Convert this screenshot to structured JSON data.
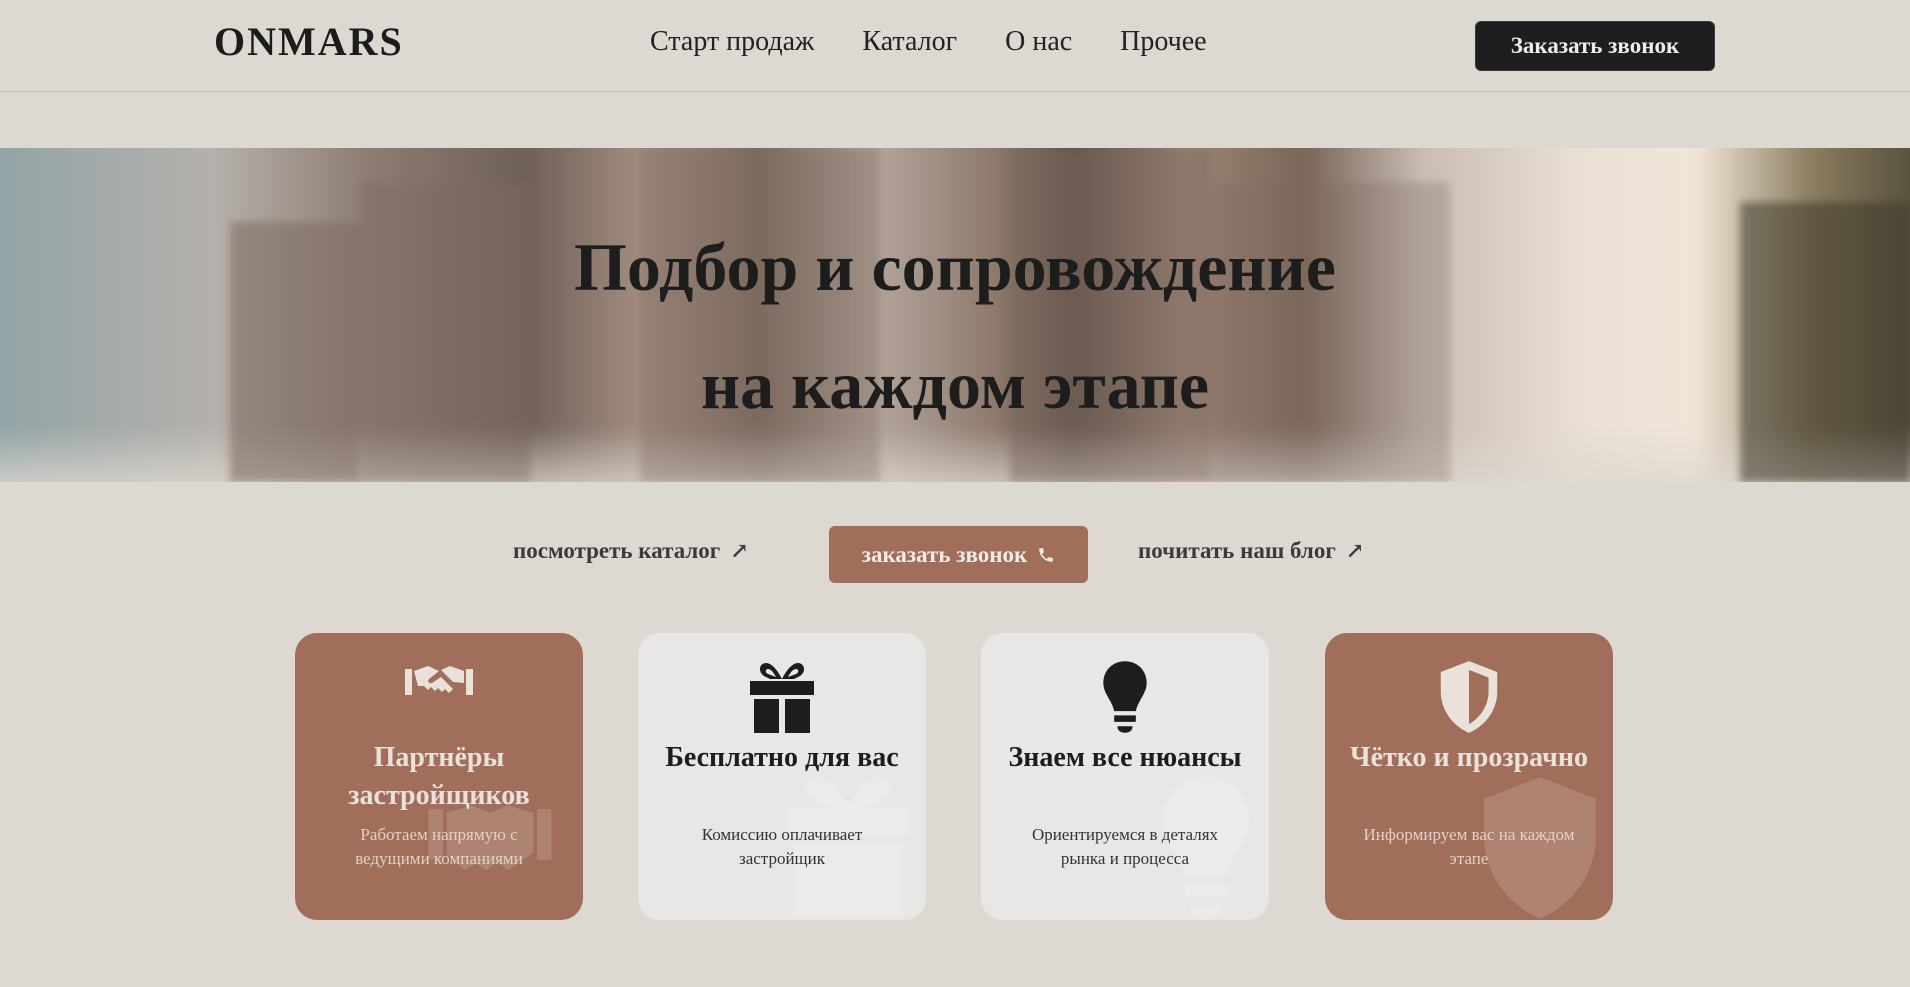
{
  "header": {
    "logo": "ONMARS",
    "nav": [
      "Старт продаж",
      "Каталог",
      "О нас",
      "Прочее"
    ],
    "cta": "Заказать звонок"
  },
  "hero": {
    "title_line1": "Подбор и сопровождение",
    "title_line2": "на каждом этапе"
  },
  "actions": {
    "catalog_link": "посмотреть каталог",
    "call_button": "заказать звонок",
    "blog_link": "почитать наш блог"
  },
  "cards": [
    {
      "icon": "handshake-icon",
      "title": "Партнёры застройщиков",
      "desc": "Работаем напрямую с ведущими компаниями",
      "style": "brown"
    },
    {
      "icon": "gift-icon",
      "title": "Бесплатно для вас",
      "desc": "Комиссию оплачивает застройщик",
      "style": "light"
    },
    {
      "icon": "lightbulb-icon",
      "title": "Знаем все нюансы",
      "desc": "Ориентируемся в деталях рынка и процесса",
      "style": "light"
    },
    {
      "icon": "shield-icon",
      "title": "Чётко и прозрачно",
      "desc": "Информируем вас на каждом этапе",
      "style": "brown"
    }
  ],
  "colors": {
    "background": "#ddd8d1",
    "accent": "#a06e5b",
    "dark_button": "#1e1e1e",
    "card_light": "#e8e7e6"
  }
}
